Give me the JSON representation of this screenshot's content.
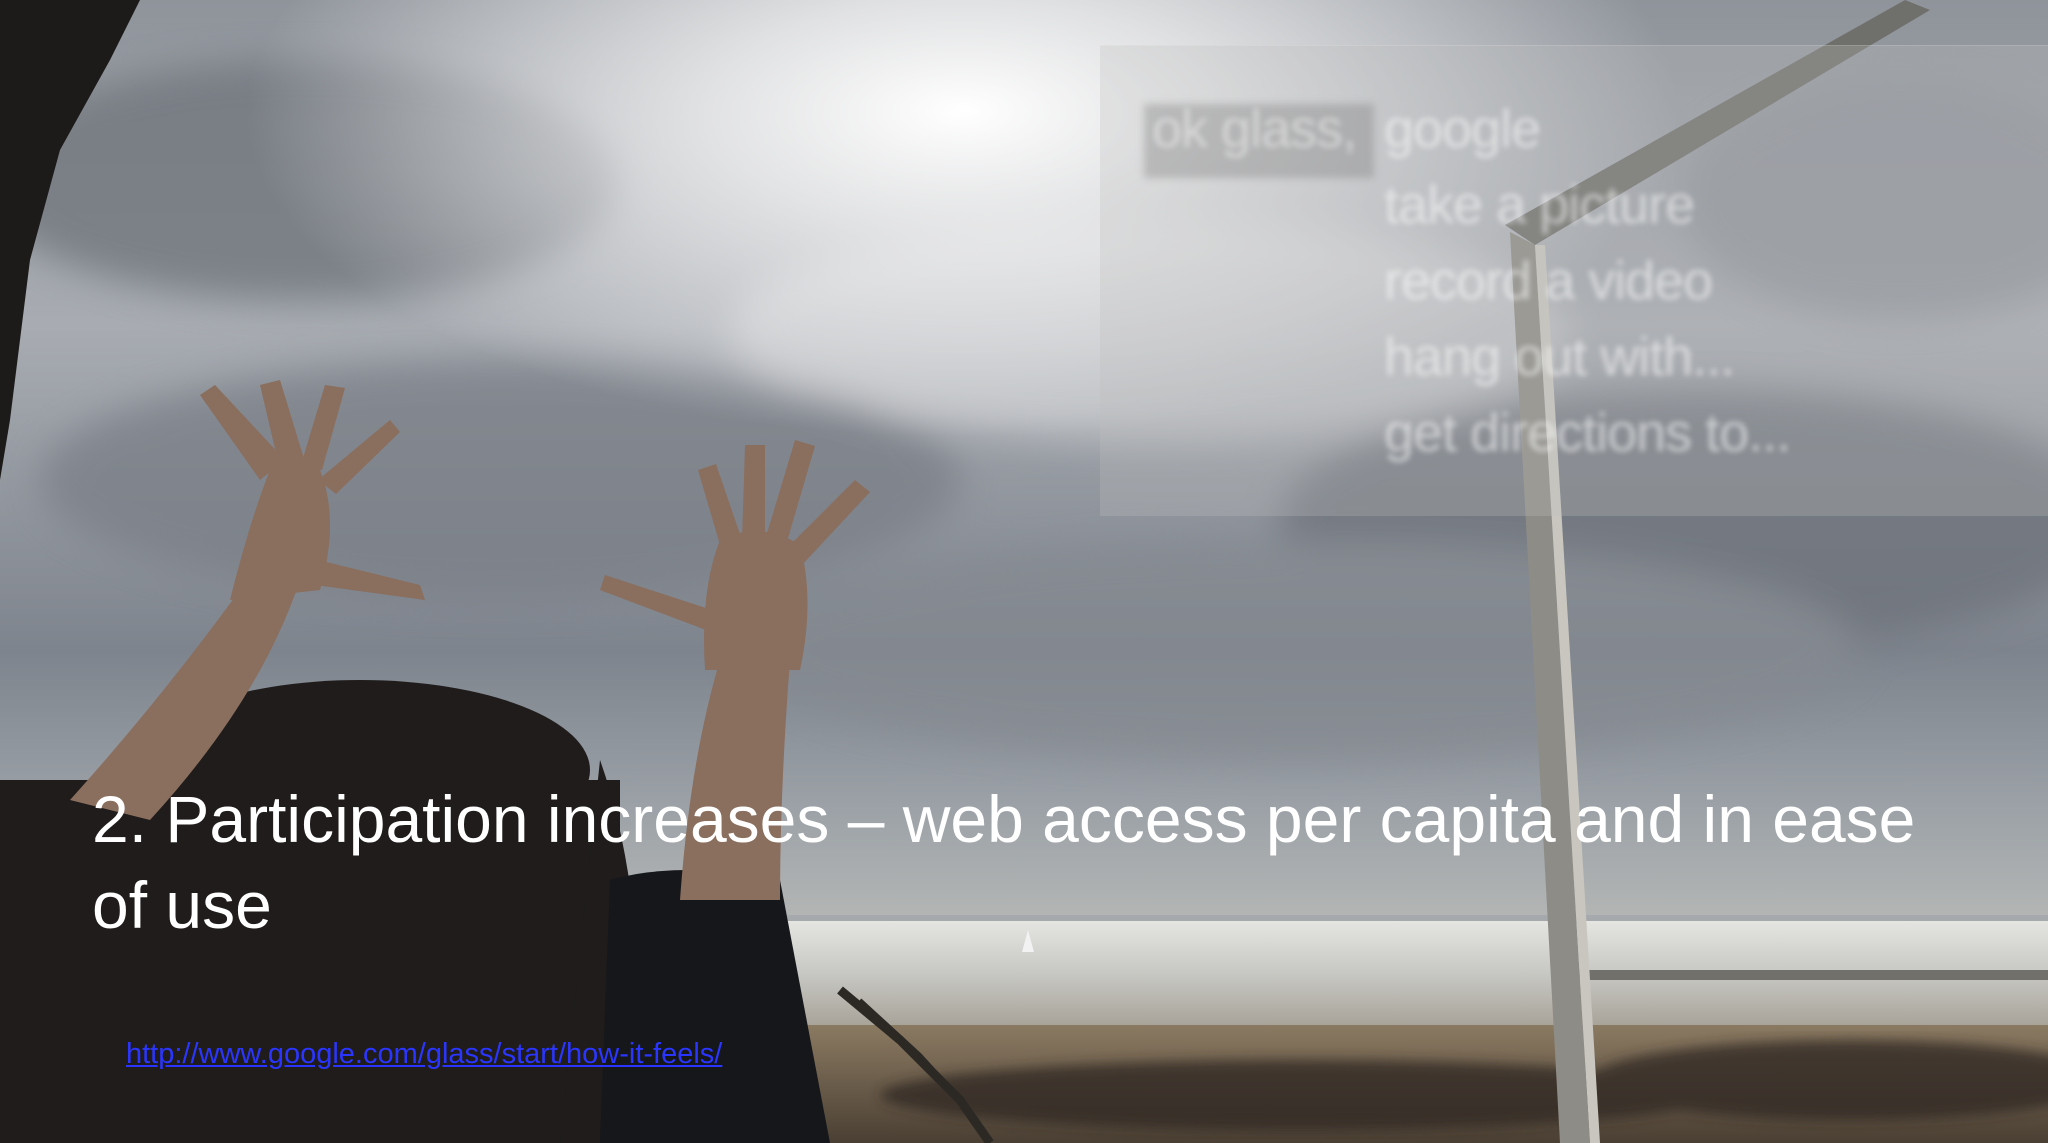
{
  "slide": {
    "caption": "2. Participation increases – web access per capita and in ease of use",
    "link_text": "http://www.google.com/glass/start/how-it-feels/"
  },
  "glass_menu": {
    "wake_phrase": "ok glass,",
    "command_word": "google",
    "options": [
      "take a picture",
      "record a video",
      "hang out with...",
      "get directions to..."
    ]
  },
  "colors": {
    "caption_text": "#ffffff",
    "link": "#2a36ff",
    "sky": "#9ea3ab",
    "sea": "#c9c9c4",
    "sand": "#6b5a46"
  },
  "icons": {
    "glass_frame": "glass-frame-icon"
  }
}
